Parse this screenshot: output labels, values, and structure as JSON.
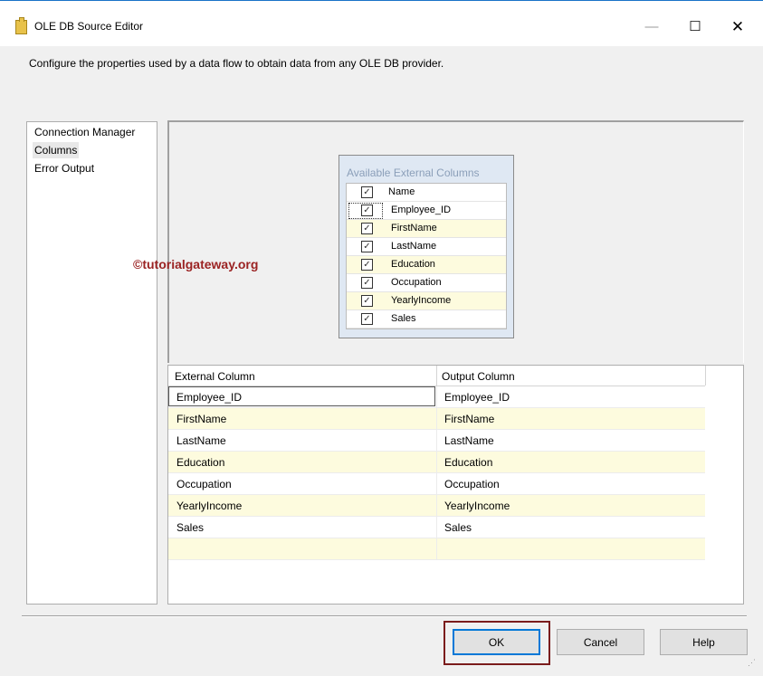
{
  "window": {
    "title": "OLE DB Source Editor",
    "minimize_glyph": "—",
    "maximize_glyph": "☐",
    "close_glyph": "✕"
  },
  "description": "Configure the properties used by a data flow to obtain data from any OLE DB provider.",
  "nav": {
    "items": [
      {
        "label": "Connection Manager"
      },
      {
        "label": "Columns"
      },
      {
        "label": "Error Output"
      }
    ],
    "selected": "Columns"
  },
  "available_columns": {
    "title": "Available External Columns",
    "header": "Name",
    "items": [
      {
        "name": "Employee_ID",
        "checked": true
      },
      {
        "name": "FirstName",
        "checked": true
      },
      {
        "name": "LastName",
        "checked": true
      },
      {
        "name": "Education",
        "checked": true
      },
      {
        "name": "Occupation",
        "checked": true
      },
      {
        "name": "YearlyIncome",
        "checked": true
      },
      {
        "name": "Sales",
        "checked": true
      }
    ],
    "check_glyph": "✓"
  },
  "watermark": "©tutorialgateway.org",
  "mapping_grid": {
    "headers": [
      "External Column",
      "Output Column"
    ],
    "rows": [
      [
        "Employee_ID",
        "Employee_ID"
      ],
      [
        "FirstName",
        "FirstName"
      ],
      [
        "LastName",
        "LastName"
      ],
      [
        "Education",
        "Education"
      ],
      [
        "Occupation",
        "Occupation"
      ],
      [
        "YearlyIncome",
        "YearlyIncome"
      ],
      [
        "Sales",
        "Sales"
      ],
      [
        "",
        ""
      ]
    ]
  },
  "buttons": {
    "ok": "OK",
    "cancel": "Cancel",
    "help": "Help"
  },
  "colors": {
    "alt_row": "#fdfbde",
    "highlight_border": "#7b1c1c",
    "watermark": "#9b2323"
  }
}
